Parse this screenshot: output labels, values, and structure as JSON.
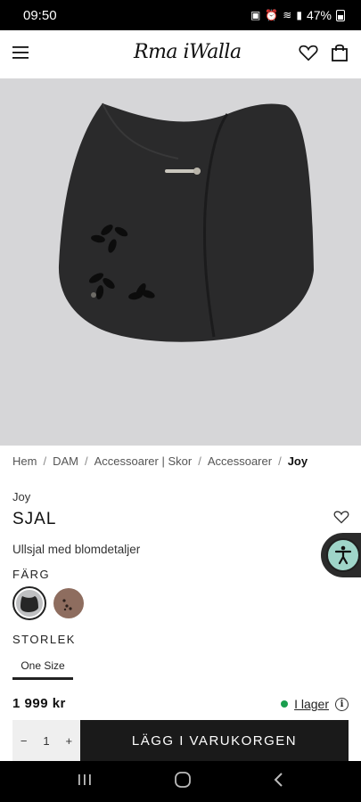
{
  "status_bar": {
    "time": "09:50",
    "battery": "47%"
  },
  "header": {
    "logo_text": "Rma iWalla",
    "menu_icon": "hamburger-menu-icon",
    "wishlist_icon": "heart-icon",
    "cart_icon": "shopping-bag-icon"
  },
  "hero": {
    "alt": "product-image-shawl",
    "background": "#d6d6d8"
  },
  "breadcrumb": {
    "items": [
      "Hem",
      "DAM",
      "Accessoarer | Skor",
      "Accessoarer"
    ],
    "current": "Joy",
    "separator": "/"
  },
  "product": {
    "brand": "Joy",
    "title": "SJAL",
    "description": "Ullsjal med blomdetaljer",
    "color_label": "FÄRG",
    "size_label": "STORLEK",
    "size_option": "One Size",
    "price": "1 999 kr",
    "stock_text": "I lager",
    "stock_color": "#1a9e4e"
  },
  "purchase": {
    "qty_minus": "−",
    "qty_value": "1",
    "qty_plus": "+",
    "add_to_cart": "LÄGG I VARUKORGEN"
  },
  "colors": {
    "accent": "#1a1a1a",
    "a11y": "#9fd5c9"
  }
}
